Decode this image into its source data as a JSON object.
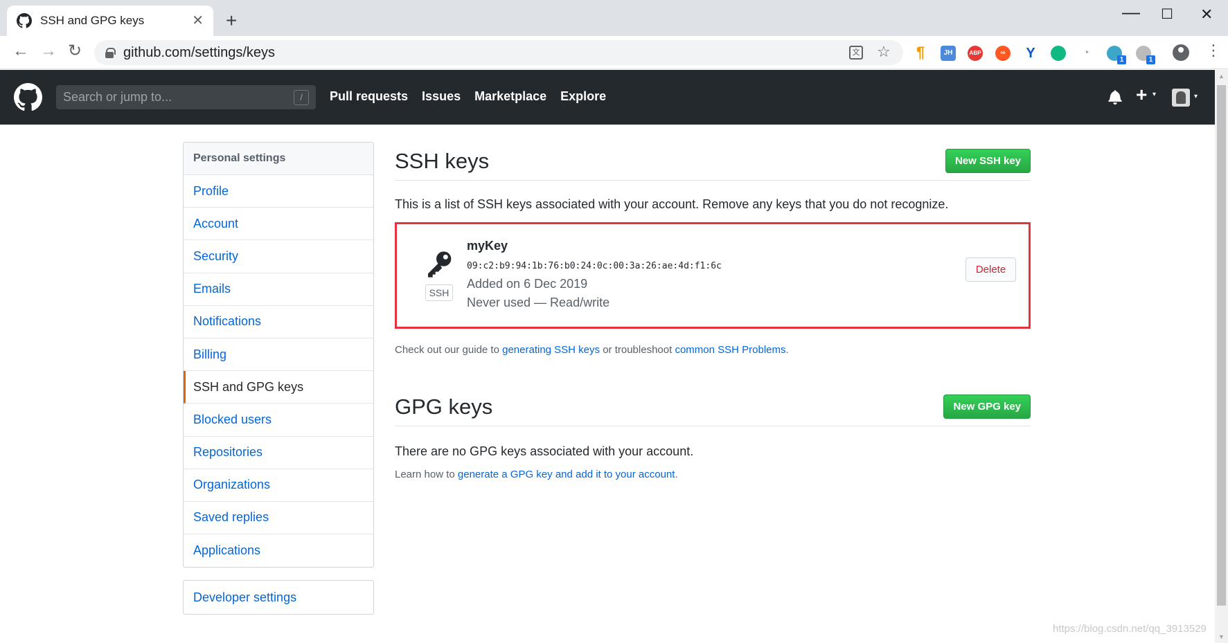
{
  "browser": {
    "tab_title": "SSH and GPG keys",
    "tab_close": "✕",
    "new_tab": "+",
    "url": "github.com/settings/keys",
    "window_controls": {
      "minimize": "—",
      "maximize": "☐",
      "close": "✕"
    },
    "extensions": [
      {
        "icon": "pilcrow-icon",
        "text": "¶"
      },
      {
        "icon": "jh-extension-icon",
        "text": "JH"
      },
      {
        "icon": "adblock-plus-icon",
        "text": "ABP"
      },
      {
        "icon": "infinity-extension-icon",
        "text": "∞"
      },
      {
        "icon": "v-extension-icon",
        "text": "Y"
      },
      {
        "icon": "green-extension-icon",
        "text": ""
      },
      {
        "icon": "gauge-extension-icon",
        "text": "◔"
      },
      {
        "icon": "globe-extension-icon",
        "text": "",
        "badge": "1"
      },
      {
        "icon": "dark-extension-icon",
        "text": "",
        "badge": "1"
      }
    ]
  },
  "header": {
    "search_placeholder": "Search or jump to...",
    "search_kbd": "/",
    "nav": [
      "Pull requests",
      "Issues",
      "Marketplace",
      "Explore"
    ],
    "plus": "+",
    "caret": "▾"
  },
  "sidebar": {
    "heading": "Personal settings",
    "items": [
      {
        "label": "Profile",
        "selected": false
      },
      {
        "label": "Account",
        "selected": false
      },
      {
        "label": "Security",
        "selected": false
      },
      {
        "label": "Emails",
        "selected": false
      },
      {
        "label": "Notifications",
        "selected": false
      },
      {
        "label": "Billing",
        "selected": false
      },
      {
        "label": "SSH and GPG keys",
        "selected": true
      },
      {
        "label": "Blocked users",
        "selected": false
      },
      {
        "label": "Repositories",
        "selected": false
      },
      {
        "label": "Organizations",
        "selected": false
      },
      {
        "label": "Saved replies",
        "selected": false
      },
      {
        "label": "Applications",
        "selected": false
      }
    ],
    "developer_settings": "Developer settings"
  },
  "ssh": {
    "title": "SSH keys",
    "new_button": "New SSH key",
    "description": "This is a list of SSH keys associated with your account. Remove any keys that you do not recognize.",
    "key": {
      "name": "myKey",
      "type_label": "SSH",
      "fingerprint": "09:c2:b9:94:1b:76:b0:24:0c:00:3a:26:ae:4d:f1:6c",
      "added": "Added on 6 Dec 2019",
      "usage": "Never used — Read/write",
      "delete_label": "Delete"
    },
    "guide_prefix": "Check out our guide to ",
    "guide_link1": "generating SSH keys",
    "guide_mid": " or troubleshoot ",
    "guide_link2": "common SSH Problems",
    "guide_suffix": "."
  },
  "gpg": {
    "title": "GPG keys",
    "new_button": "New GPG key",
    "empty": "There are no GPG keys associated with your account.",
    "learn_prefix": "Learn how to ",
    "learn_link": "generate a GPG key and add it to your account",
    "learn_suffix": "."
  },
  "watermark": "https://blog.csdn.net/qq_3913529",
  "colors": {
    "header_bg": "#24292e",
    "link": "#0366d6",
    "primary_green": "#28a745",
    "danger": "#cb2431",
    "highlight_box": "#e5323c",
    "selected_accent": "#e36209"
  }
}
